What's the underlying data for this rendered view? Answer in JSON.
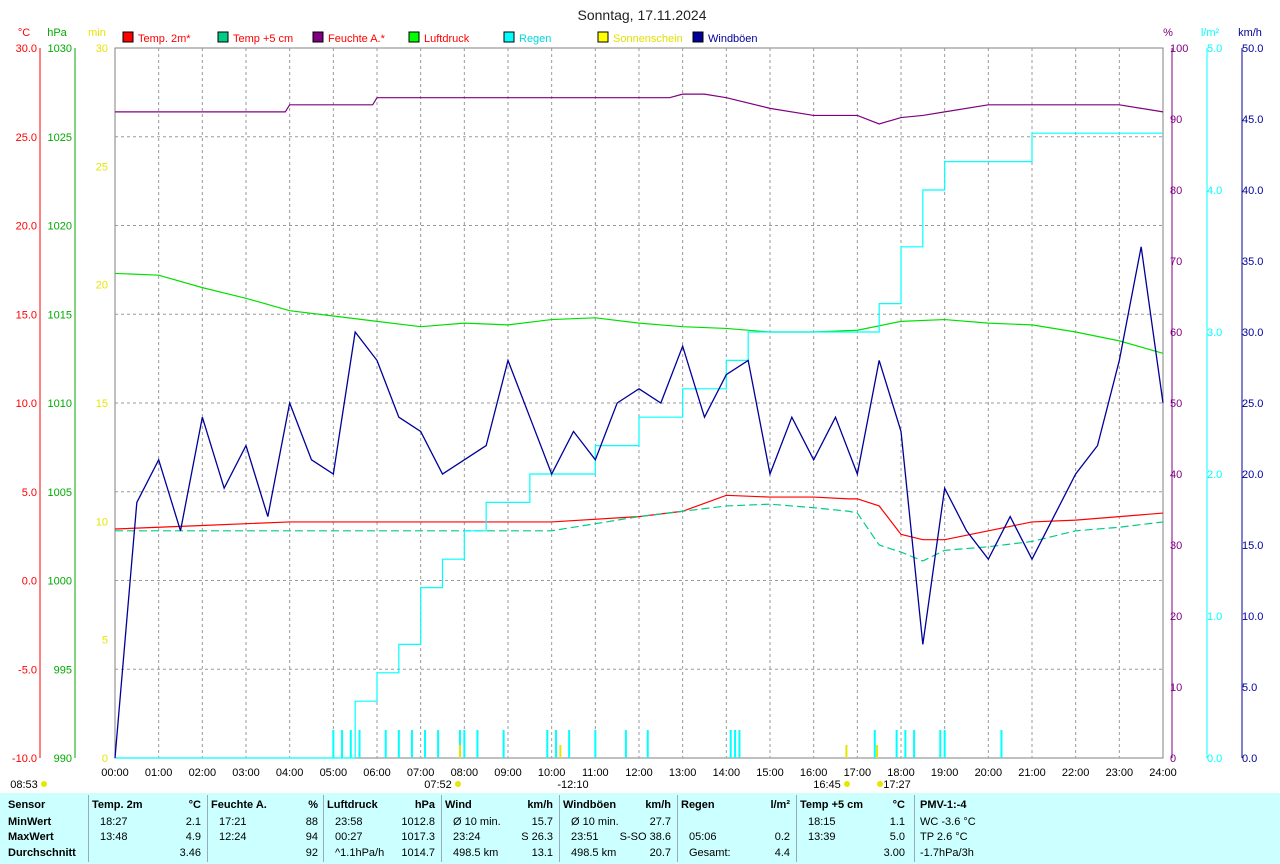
{
  "title": "Sonntag, 17.11.2024",
  "legend": [
    {
      "label": "Temp. 2m*",
      "color": "#ff0000",
      "text_color": "#ff0000"
    },
    {
      "label": "Temp +5 cm",
      "color": "#00cc88",
      "text_color": "#ff0000"
    },
    {
      "label": "Feuchte A.*",
      "color": "#800080",
      "text_color": "#ff0000"
    },
    {
      "label": "Luftdruck",
      "color": "#00ff00",
      "text_color": "#ff0000"
    },
    {
      "label": "Regen",
      "color": "#00ffff",
      "text_color": "#00d8d8"
    },
    {
      "label": "Sonnenschein",
      "color": "#ffff00",
      "text_color": "#e0e000"
    },
    {
      "label": "Windböen",
      "color": "#000099",
      "text_color": "#000099"
    }
  ],
  "axes": {
    "temp": {
      "unit": "°C",
      "color": "#ff0000",
      "ticks": [
        "30.0",
        "25.0",
        "20.0",
        "15.0",
        "10.0",
        "5.0",
        "0.0",
        "-5.0",
        "-10.0"
      ]
    },
    "press": {
      "unit": "hPa",
      "color": "#00aa00",
      "ticks": [
        "1030",
        "1025",
        "1020",
        "1015",
        "1010",
        "1005",
        "1000",
        "995",
        "990"
      ]
    },
    "sun": {
      "unit": "min",
      "color": "#e6e600",
      "ticks": [
        "30",
        "25",
        "20",
        "15",
        "10",
        "5",
        "0"
      ]
    },
    "hum": {
      "unit": "%",
      "color": "#800080",
      "ticks": [
        "100",
        "90",
        "80",
        "70",
        "60",
        "50",
        "40",
        "30",
        "20",
        "10",
        "0"
      ]
    },
    "rain": {
      "unit": "l/m²",
      "color": "#00ffff",
      "ticks": [
        "5.0",
        "4.0",
        "3.0",
        "2.0",
        "1.0",
        "0.0"
      ]
    },
    "wind": {
      "unit": "km/h",
      "color": "#000099",
      "ticks": [
        "50.0",
        "45.0",
        "40.0",
        "35.0",
        "30.0",
        "25.0",
        "20.0",
        "15.0",
        "10.0",
        "5.0",
        "0.0"
      ]
    },
    "x_ticks": [
      "00:00",
      "01:00",
      "02:00",
      "03:00",
      "04:00",
      "05:00",
      "06:00",
      "07:00",
      "08:00",
      "09:00",
      "10:00",
      "11:00",
      "12:00",
      "13:00",
      "14:00",
      "15:00",
      "16:00",
      "17:00",
      "18:00",
      "19:00",
      "20:00",
      "21:00",
      "22:00",
      "23:00",
      "24:00"
    ]
  },
  "sun_markers": {
    "sunrise": "07:52",
    "sunset": "16:45",
    "noon": "12:10",
    "noon_label": "-12:10",
    "first": "08:53",
    "last_label": "17:27"
  },
  "chart_data": {
    "type": "line",
    "x_unit": "hour",
    "x_range": [
      0,
      24
    ],
    "series": [
      {
        "name": "Temp. 2m*",
        "axis": "temp",
        "x": [
          0,
          2,
          3,
          4,
          5,
          8,
          10,
          12,
          13,
          14,
          15,
          16,
          16.8,
          17,
          17.5,
          18,
          18.5,
          19,
          20,
          21,
          22,
          23,
          24
        ],
        "y": [
          2.9,
          3.1,
          3.2,
          3.3,
          3.3,
          3.3,
          3.3,
          3.6,
          3.9,
          4.8,
          4.7,
          4.7,
          4.6,
          4.6,
          4.2,
          2.6,
          2.3,
          2.3,
          2.8,
          3.3,
          3.4,
          3.6,
          3.8
        ]
      },
      {
        "name": "Temp +5 cm",
        "axis": "temp",
        "x": [
          0,
          1.5,
          2,
          5,
          8,
          10,
          12,
          13,
          14,
          15,
          16,
          16.8,
          17,
          17.5,
          18,
          18.5,
          19,
          20,
          21,
          22,
          23,
          24
        ],
        "y": [
          2.8,
          2.8,
          2.8,
          2.8,
          2.8,
          2.8,
          3.6,
          3.9,
          4.2,
          4.3,
          4.1,
          3.9,
          3.8,
          2.0,
          1.6,
          1.1,
          1.7,
          1.9,
          2.2,
          2.8,
          3.0,
          3.3
        ]
      },
      {
        "name": "Feuchte A.*",
        "axis": "hum",
        "x": [
          0,
          3.9,
          4,
          5.9,
          6,
          12,
          12.7,
          13,
          13.5,
          14,
          15,
          16,
          17,
          17.5,
          18,
          18.5,
          19,
          20,
          21,
          22,
          23,
          23.5,
          24
        ],
        "y": [
          91,
          91,
          92,
          92,
          93,
          93,
          93,
          93.5,
          93.5,
          93,
          91.5,
          90.5,
          90.5,
          89.3,
          90.2,
          90.5,
          91,
          92,
          92,
          92,
          92,
          91.5,
          91
        ]
      },
      {
        "name": "Luftdruck",
        "axis": "press",
        "x": [
          0,
          1,
          2,
          3,
          4,
          5,
          6,
          7,
          8,
          9,
          10,
          11,
          12,
          13,
          14,
          15,
          16,
          17,
          18,
          19,
          20,
          21,
          22,
          23,
          24
        ],
        "y": [
          1017.3,
          1017.2,
          1016.5,
          1015.9,
          1015.2,
          1014.9,
          1014.6,
          1014.3,
          1014.5,
          1014.4,
          1014.7,
          1014.8,
          1014.5,
          1014.3,
          1014.2,
          1014.0,
          1014.0,
          1014.1,
          1014.6,
          1014.7,
          1014.5,
          1014.4,
          1014.0,
          1013.5,
          1012.8
        ]
      },
      {
        "name": "Regen",
        "axis": "rain",
        "x": [
          0,
          5,
          5.5,
          6,
          6.5,
          7,
          7.5,
          8,
          8.5,
          9,
          9.5,
          10,
          11,
          12,
          13,
          14,
          14.5,
          15,
          16,
          17,
          17.5,
          18,
          18.5,
          19,
          20,
          21,
          22,
          23,
          24
        ],
        "y": [
          0,
          0,
          0.4,
          0.6,
          0.8,
          1.2,
          1.4,
          1.6,
          1.8,
          1.8,
          2.0,
          2.0,
          2.2,
          2.4,
          2.6,
          2.8,
          3.0,
          3.0,
          3.0,
          3.0,
          3.2,
          3.6,
          4.0,
          4.2,
          4.2,
          4.4,
          4.4,
          4.4,
          4.4
        ]
      },
      {
        "name": "Windböen",
        "axis": "wind",
        "x": [
          0,
          0.5,
          1,
          1.5,
          2,
          2.5,
          3,
          3.5,
          4,
          4.5,
          5,
          5.5,
          6,
          6.5,
          7,
          7.5,
          8,
          8.5,
          9,
          9.5,
          10,
          10.5,
          11,
          11.5,
          12,
          12.5,
          13,
          13.5,
          14,
          14.5,
          15,
          15.5,
          16,
          16.5,
          17,
          17.5,
          18,
          18.5,
          19,
          19.5,
          20,
          20.5,
          21,
          21.5,
          22,
          22.5,
          23,
          23.5,
          24
        ],
        "y": [
          0,
          18,
          21,
          16,
          24,
          19,
          22,
          17,
          25,
          21,
          20,
          30,
          28,
          24,
          23,
          20,
          21,
          22,
          28,
          24,
          20,
          23,
          21,
          25,
          26,
          25,
          29,
          24,
          27,
          28,
          20,
          24,
          21,
          24,
          20,
          28,
          23,
          8,
          19,
          16,
          14,
          17,
          14,
          17,
          20,
          22,
          28,
          36,
          25
        ]
      }
    ],
    "rain_events": {
      "x": [
        5.0,
        5.2,
        5.4,
        5.6,
        6.2,
        6.5,
        6.8,
        7.1,
        7.4,
        7.9,
        8.0,
        8.3,
        8.9,
        9.9,
        10.1,
        10.4,
        11.0,
        11.7,
        12.2,
        14.1,
        14.2,
        14.3,
        17.4,
        17.9,
        18.1,
        18.3,
        18.9,
        19.0,
        20.3
      ]
    },
    "sunshine_events": {
      "x": [
        7.9,
        10.2,
        16.75,
        17.45
      ]
    }
  },
  "table": {
    "sensor": {
      "h": "Sensor",
      "r1": "MinWert",
      "r2": "MaxWert",
      "r3": "Durchschnitt"
    },
    "groups": [
      {
        "h1": "Temp. 2m",
        "h2": "°C",
        "t1": "18:27",
        "v1": "2.1",
        "t2": "13:48",
        "v2": "4.9",
        "t3": "",
        "v3": "3.46"
      },
      {
        "h1": "Feuchte A.",
        "h2": "%",
        "t1": "17:21",
        "v1": "88",
        "t2": "12:24",
        "v2": "94",
        "t3": "",
        "v3": "92"
      },
      {
        "h1": "Luftdruck",
        "h2": "hPa",
        "t1": "23:58",
        "v1": "1012.8",
        "t2": "00:27",
        "v2": "1017.3",
        "t3": "^1.1hPa/h",
        "v3": "1014.7"
      },
      {
        "h1": "Wind",
        "h2": "km/h",
        "t1": "Ø 10 min.",
        "v1": "15.7",
        "t2": "23:24",
        "v2": "S 26.3",
        "t3": "498.5 km",
        "v3": "13.1"
      },
      {
        "h1": "Windböen",
        "h2": "km/h",
        "t1": "Ø 10 min.",
        "v1": "27.7",
        "t2": "23:51",
        "v2": "S-SO 38.6",
        "t3": "498.5 km",
        "v3": "20.7"
      },
      {
        "h1": "Regen",
        "h2": "l/m²",
        "t1": "",
        "v1": "",
        "t2": "05:06",
        "v2": "0.2",
        "t3": "Gesamt:",
        "v3": "4.4"
      },
      {
        "h1": "Temp +5 cm",
        "h2": "°C",
        "t1": "18:15",
        "v1": "1.1",
        "t2": "13:39",
        "v2": "5.0",
        "t3": "",
        "v3": "3.00"
      }
    ],
    "pmv": {
      "h": "PMV-1:-4",
      "r1": "WC -3.6 °C",
      "r2": "TP 2.6 °C",
      "r3": "-1.7hPa/3h"
    }
  }
}
